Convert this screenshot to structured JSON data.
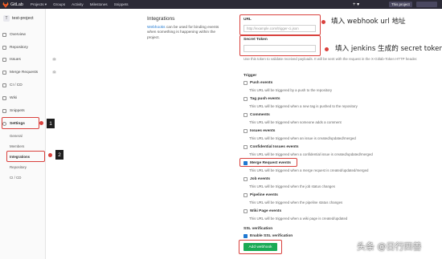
{
  "topbar": {
    "brand": "GitLab",
    "nav": [
      "Projects ▾",
      "Groups",
      "Activity",
      "Milestones",
      "Snippets"
    ],
    "plus": "+ ▾",
    "this_project": "This project"
  },
  "sidebar": {
    "project_initial": "T",
    "project_name": "test-project",
    "items": [
      {
        "label": "Overview"
      },
      {
        "label": "Repository"
      },
      {
        "label": "Issues",
        "count": "0"
      },
      {
        "label": "Merge Requests",
        "count": "0"
      },
      {
        "label": "CI / CD"
      },
      {
        "label": "Wiki"
      },
      {
        "label": "Snippets"
      },
      {
        "label": "Settings"
      }
    ],
    "settings_sub": [
      "General",
      "Members",
      "Integrations",
      "Repository",
      "CI / CD"
    ]
  },
  "main": {
    "heading": "Integrations",
    "desc_link": "Webhooks",
    "desc_rest": " can be used for binding events when something is happening within the project.",
    "url_label": "URL",
    "url_placeholder": "http://example.com/trigger-ci.json",
    "secret_label": "Secret Token",
    "secret_help": "Use this token to validate received payloads. It will be sent with the request in the X-Gitlab-Token HTTP header.",
    "trigger_label": "Trigger",
    "triggers": [
      {
        "label": "Push events",
        "desc": "This URL will be triggered by a push to the repository",
        "checked": false
      },
      {
        "label": "Tag push events",
        "desc": "This URL will be triggered when a new tag is pushed to the repository",
        "checked": false
      },
      {
        "label": "Comments",
        "desc": "This URL will be triggered when someone adds a comment",
        "checked": false
      },
      {
        "label": "Issues events",
        "desc": "This URL will be triggered when an issue is created/updated/merged",
        "checked": false
      },
      {
        "label": "Confidential Issues events",
        "desc": "This URL will be triggered when a confidential issue is created/updated/merged",
        "checked": false
      },
      {
        "label": "Merge Request events",
        "desc": "This URL will be triggered when a merge request is created/updated/merged",
        "checked": true
      },
      {
        "label": "Job events",
        "desc": "This URL will be triggered when the job status changes",
        "checked": false
      },
      {
        "label": "Pipeline events",
        "desc": "This URL will be triggered when the pipeline status changes",
        "checked": false
      },
      {
        "label": "Wiki Page events",
        "desc": "This URL will be triggered when a wiki page is created/updated",
        "checked": false
      }
    ],
    "ssl_label": "SSL verification",
    "ssl_checkbox": "Enable SSL verification",
    "add_button": "Add webhook"
  },
  "annotations": {
    "url_callout": "填入 webhook url 地址",
    "token_callout": "填入 jenkins 生成的 secret token",
    "num1": "1",
    "num2": "2",
    "accent_red": "#d9413d"
  },
  "watermark": "头条 @日行四善"
}
